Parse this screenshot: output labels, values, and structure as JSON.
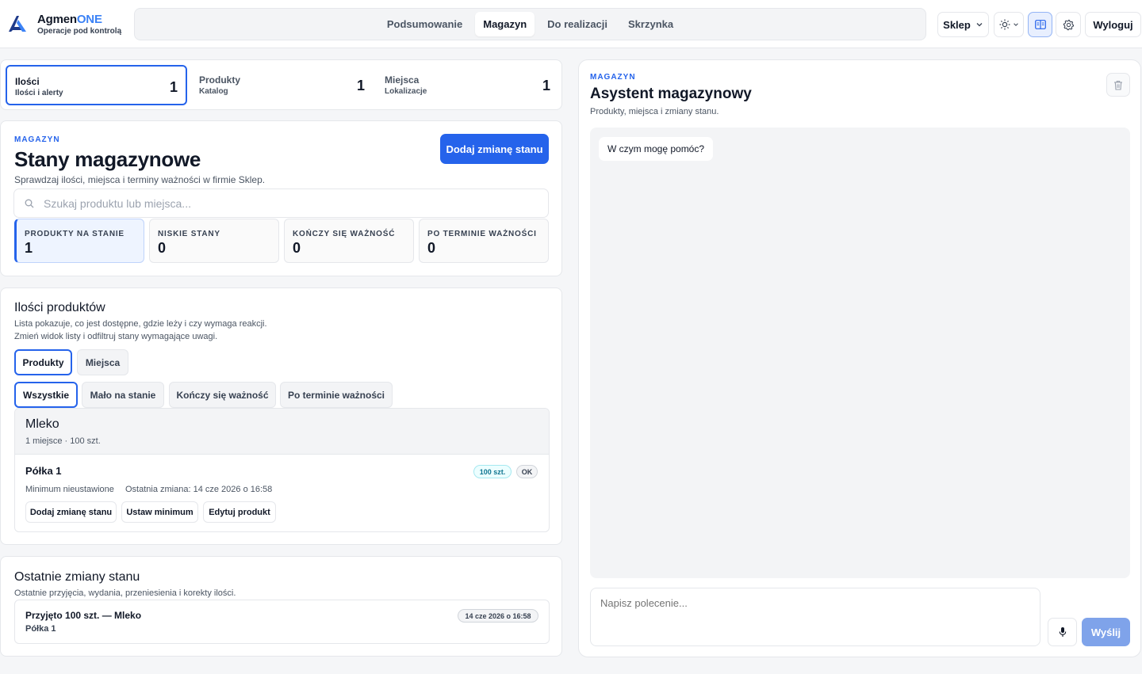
{
  "brand": {
    "name_main": "Agmen",
    "name_accent": "ONE",
    "tagline": "Operacje pod kontrolą"
  },
  "nav": {
    "items": [
      "Podsumowanie",
      "Magazyn",
      "Do realizacji",
      "Skrzynka"
    ],
    "active": "Magazyn"
  },
  "header_actions": {
    "store_label": "Sklep",
    "logout_label": "Wyloguj"
  },
  "top_tabs": [
    {
      "title": "Ilości",
      "subtitle": "Ilości i alerty",
      "count": "1"
    },
    {
      "title": "Produkty",
      "subtitle": "Katalog",
      "count": "1"
    },
    {
      "title": "Miejsca",
      "subtitle": "Lokalizacje",
      "count": "1"
    }
  ],
  "stock": {
    "eyebrow": "MAGAZYN",
    "title": "Stany magazynowe",
    "description": "Sprawdzaj ilości, miejsca i terminy ważności w firmie Sklep.",
    "add_button": "Dodaj zmianę stanu",
    "search_placeholder": "Szukaj produktu lub miejsca...",
    "stats": [
      {
        "label": "PRODUKTY NA STANIE",
        "value": "1"
      },
      {
        "label": "NISKIE STANY",
        "value": "0"
      },
      {
        "label": "KOŃCZY SIĘ WAŻNOŚĆ",
        "value": "0"
      },
      {
        "label": "PO TERMINIE WAŻNOŚCI",
        "value": "0"
      }
    ]
  },
  "quantities": {
    "title": "Ilości produktów",
    "desc1": "Lista pokazuje, co jest dostępne, gdzie leży i czy wymaga reakcji.",
    "desc2": "Zmień widok listy i odfiltruj stany wymagające uwagi.",
    "views": [
      "Produkty",
      "Miejsca"
    ],
    "filters": [
      "Wszystkie",
      "Mało na stanie",
      "Kończy się ważność",
      "Po terminie ważności"
    ],
    "product": {
      "name": "Mleko",
      "meta": "1 miejsce · 100 szt.",
      "location": {
        "name": "Półka 1",
        "qty_badge": "100 szt.",
        "status_badge": "OK",
        "minimum": "Minimum nieustawione",
        "last_change": "Ostatnia zmiana: 14 cze 2026 o 16:58",
        "actions": [
          "Dodaj zmianę stanu",
          "Ustaw minimum",
          "Edytuj produkt"
        ]
      }
    }
  },
  "recent": {
    "title": "Ostatnie zmiany stanu",
    "description": "Ostatnie przyjęcia, wydania, przeniesienia i korekty ilości.",
    "entry": {
      "title": "Przyjęto 100 szt. — Mleko",
      "location": "Półka 1",
      "time": "14 cze 2026 o 16:58"
    }
  },
  "assistant": {
    "eyebrow": "MAGAZYN",
    "title": "Asystent magazynowy",
    "subtitle": "Produkty, miejsca i zmiany stanu.",
    "greeting": "W czym mogę pomóc?",
    "input_placeholder": "Napisz polecenie...",
    "send_label": "Wyślij"
  },
  "colors": {
    "accent": "#2563eb",
    "send_disabled": "#7fa3ea",
    "qty_badge": "#0e7490"
  },
  "icons": [
    "logo-icon",
    "chevron-down-icon",
    "sun-icon",
    "layout-icon",
    "gear-icon",
    "search-icon",
    "trash-icon",
    "microphone-icon"
  ]
}
